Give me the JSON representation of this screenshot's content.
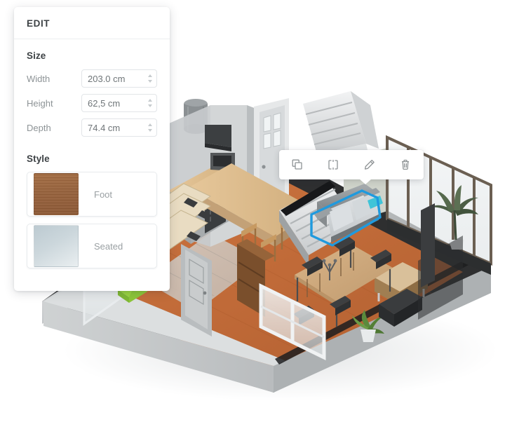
{
  "app": {
    "kind": "3d-floorplan-editor",
    "accent_selection_color": "#1f9ade",
    "floor_color": "#c06a38",
    "wall_color": "#c9cccd"
  },
  "edit_panel": {
    "title": "EDIT",
    "size_section": {
      "heading": "Size",
      "fields": [
        {
          "label": "Width",
          "value": "203.0 cm",
          "name": "width-field"
        },
        {
          "label": "Height",
          "value": "62,5 cm",
          "name": "height-field"
        },
        {
          "label": "Depth",
          "value": "74.4 cm",
          "name": "depth-field"
        }
      ],
      "stepper_icon": "spinner-arrows-icon"
    },
    "style_section": {
      "heading": "Style",
      "options": [
        {
          "label": "Foot",
          "swatch": "wood",
          "swatch_color": "#95603a"
        },
        {
          "label": "Seated",
          "swatch": "fabric",
          "swatch_color": "#ccd7dc"
        }
      ]
    }
  },
  "object_toolbar": {
    "buttons": [
      {
        "name": "duplicate-button",
        "icon": "copy-icon",
        "label": "Duplicate"
      },
      {
        "name": "mirror-button",
        "icon": "mirror-icon",
        "label": "Mirror"
      },
      {
        "name": "edit-button",
        "icon": "pencil-icon",
        "label": "Edit"
      },
      {
        "name": "delete-button",
        "icon": "trash-icon",
        "label": "Delete"
      }
    ]
  },
  "scene": {
    "selected_object": "sofa",
    "selection_outline_color": "#1f9ade",
    "items": [
      "kitchen-counter",
      "kitchen-island",
      "bar-stools",
      "refrigerator",
      "microwave",
      "oven",
      "entry-door",
      "staircase",
      "sofa",
      "dining-table",
      "dining-chairs",
      "sideboard",
      "potted-palm",
      "potted-plant",
      "bookshelf",
      "green-armchair",
      "window-wall",
      "sliding-windows",
      "water-heater"
    ]
  }
}
